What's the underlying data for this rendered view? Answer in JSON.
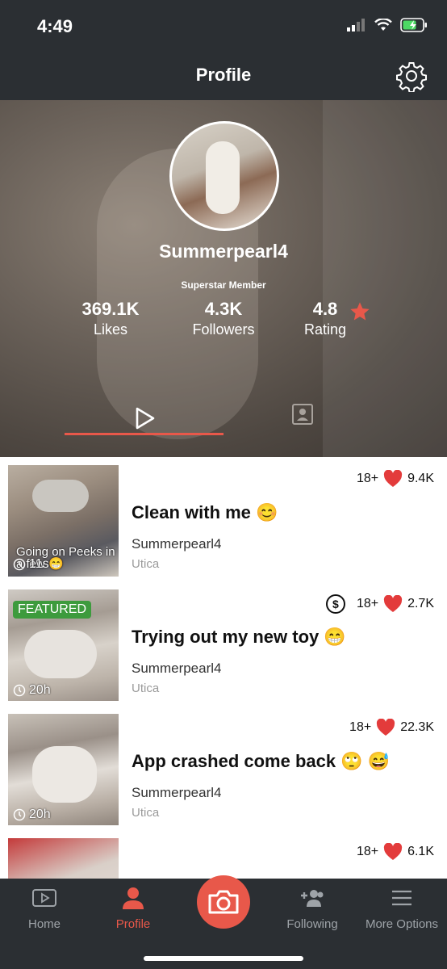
{
  "status_bar": {
    "time": "4:49"
  },
  "nav": {
    "title": "Profile"
  },
  "profile": {
    "username": "Summerpearl4",
    "member_level": "Superstar Member",
    "stats": [
      {
        "value": "369.1K",
        "label": "Likes"
      },
      {
        "value": "4.3K",
        "label": "Followers"
      },
      {
        "value": "4.8",
        "label": "Rating"
      }
    ]
  },
  "posts": [
    {
      "title": "Clean with me 😊",
      "user": "Summerpearl4",
      "location": "Utica",
      "age_rating": "18+",
      "likes": "9.4K",
      "thumb_caption": "Going on Peeks in a few 😁",
      "time": "11s",
      "featured": "",
      "paid": false
    },
    {
      "title": "Trying out my new toy 😁",
      "user": "Summerpearl4",
      "location": "Utica",
      "age_rating": "18+",
      "likes": "2.7K",
      "thumb_caption": "",
      "time": "20h",
      "featured": "FEATURED",
      "paid": true
    },
    {
      "title": "App crashed come back 🙄 😅",
      "user": "Summerpearl4",
      "location": "Utica",
      "age_rating": "18+",
      "likes": "22.3K",
      "thumb_caption": "",
      "time": "20h",
      "featured": "",
      "paid": false
    },
    {
      "title": "",
      "user": "",
      "location": "",
      "age_rating": "18+",
      "likes": "6.1K",
      "thumb_caption": "",
      "time": "",
      "featured": "",
      "paid": false
    }
  ],
  "tab_bar": {
    "items": [
      {
        "label": "Home",
        "icon": "video-icon"
      },
      {
        "label": "Profile",
        "icon": "person-icon"
      },
      {
        "label": "",
        "icon": "camera-icon"
      },
      {
        "label": "Following",
        "icon": "add-user-icon"
      },
      {
        "label": "More Options",
        "icon": "menu-icon"
      }
    ]
  },
  "colors": {
    "accent": "#e8584a",
    "featured": "#3d9b3d",
    "heart": "#e33b3b",
    "bar_bg": "#2b2f33"
  }
}
